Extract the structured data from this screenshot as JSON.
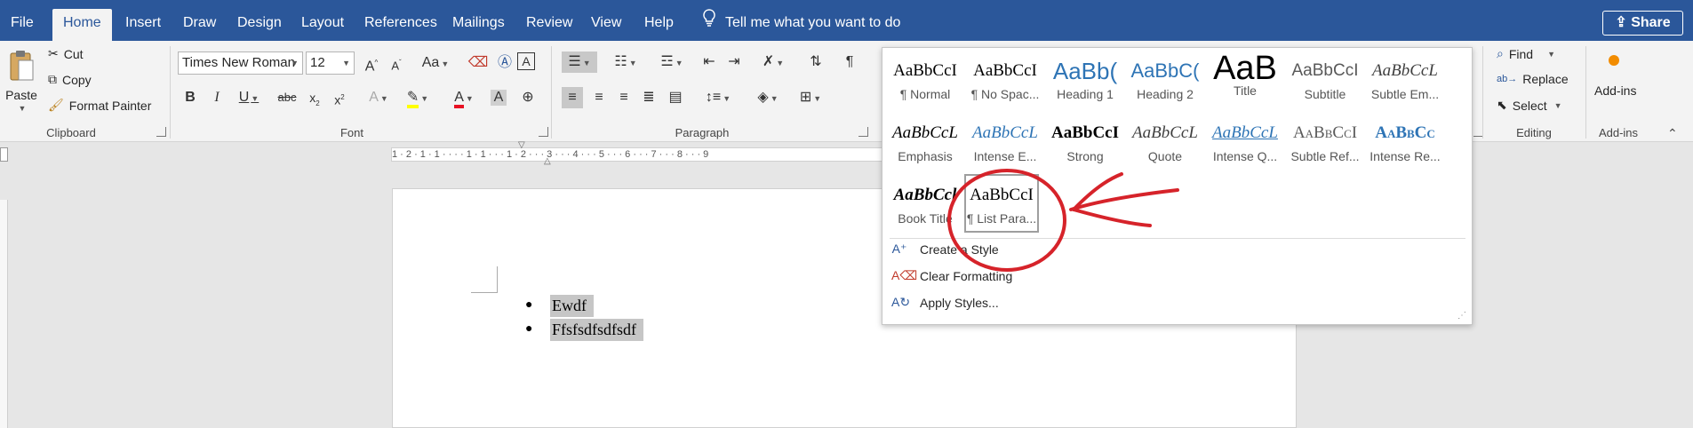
{
  "tabs": [
    "File",
    "Home",
    "Insert",
    "Draw",
    "Design",
    "Layout",
    "References",
    "Mailings",
    "Review",
    "View",
    "Help"
  ],
  "tell_me": "Tell me what you want to do",
  "share_label": "Share",
  "clipboard": {
    "paste": "Paste",
    "cut": "Cut",
    "copy": "Copy",
    "format_painter": "Format Painter",
    "label": "Clipboard"
  },
  "font": {
    "name": "Times New Roman",
    "size": "12",
    "label": "Font"
  },
  "paragraph": {
    "label": "Paragraph"
  },
  "editing": {
    "find": "Find",
    "replace": "Replace",
    "select": "Select",
    "label": "Editing"
  },
  "addins": {
    "button": "Add-ins",
    "label": "Add-ins"
  },
  "ruler": "1 · 2 · 1 · 1 · · · · 1 · 1 · · · 1 · 2 · · · 3 · · · 4 · · · 5 · · · 6 · · · 7 · · · 8 · · · 9",
  "document": {
    "items": [
      "Ewdf",
      "Ffsfsdfsdfsdf"
    ]
  },
  "gallery": {
    "styles": [
      {
        "preview": "AaBbCcI",
        "name": "¶ Normal"
      },
      {
        "preview": "AaBbCcI",
        "name": "¶ No Spac..."
      },
      {
        "preview": "AaBb(",
        "name": "Heading 1"
      },
      {
        "preview": "AaBbC(",
        "name": "Heading 2"
      },
      {
        "preview": "AaB",
        "name": "Title"
      },
      {
        "preview": "AaBbCcI",
        "name": "Subtitle"
      },
      {
        "preview": "AaBbCcL",
        "name": "Subtle Em..."
      },
      {
        "preview": "AaBbCcL",
        "name": "Emphasis"
      },
      {
        "preview": "AaBbCcL",
        "name": "Intense E..."
      },
      {
        "preview": "AaBbCcI",
        "name": "Strong"
      },
      {
        "preview": "AaBbCcL",
        "name": "Quote"
      },
      {
        "preview": "AaBbCcL",
        "name": "Intense Q..."
      },
      {
        "preview": "AaBbCcI",
        "name": "Subtle Ref..."
      },
      {
        "preview": "AaBbCc",
        "name": "Intense Re..."
      },
      {
        "preview": "AaBbCcl",
        "name": "Book Title"
      },
      {
        "preview": "AaBbCcI",
        "name": "¶ List Para..."
      }
    ],
    "menu": [
      "Create a Style",
      "Clear Formatting",
      "Apply Styles..."
    ]
  },
  "colors": {
    "accent": "#2b579a",
    "annotation": "#d6232a",
    "highlight": "#ffff00",
    "font_red": "#e81123"
  }
}
